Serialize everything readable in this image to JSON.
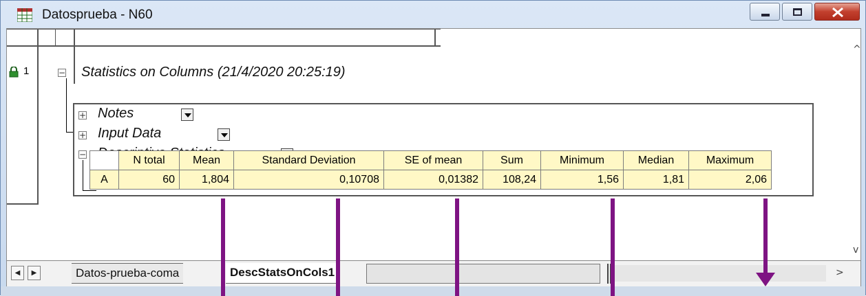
{
  "window": {
    "title": "Datosprueba - N60"
  },
  "worksheet": {
    "row_number": "1",
    "tree": {
      "root_label": "Statistics on Columns (21/4/2020 20:25:19)",
      "notes_label": "Notes",
      "input_data_label": "Input Data",
      "descriptive_label": "Descriptive Statistics"
    },
    "stats_table": {
      "headers": [
        "N total",
        "Mean",
        "Standard Deviation",
        "SE of mean",
        "Sum",
        "Minimum",
        "Median",
        "Maximum"
      ],
      "rows": [
        {
          "label": "A",
          "values": [
            "60",
            "1,804",
            "0,10708",
            "0,01382",
            "108,24",
            "1,56",
            "1,81",
            "2,06"
          ]
        }
      ]
    }
  },
  "sheet_tabs": {
    "tab1": "Datos-prueba-coma",
    "tab2": "DescStatsOnCols1"
  },
  "colors": {
    "annotation": "#7e1483",
    "table_fill": "#fff8c6",
    "close_button": "#c2402e"
  },
  "icons": [
    "app-grid-icon",
    "lock-icon",
    "minimize-icon",
    "maximize-icon",
    "close-icon",
    "expand-icon",
    "collapse-icon",
    "dropdown-icon",
    "scroll-up-icon",
    "scroll-down-icon",
    "scroll-left-icon",
    "scroll-right-icon"
  ]
}
